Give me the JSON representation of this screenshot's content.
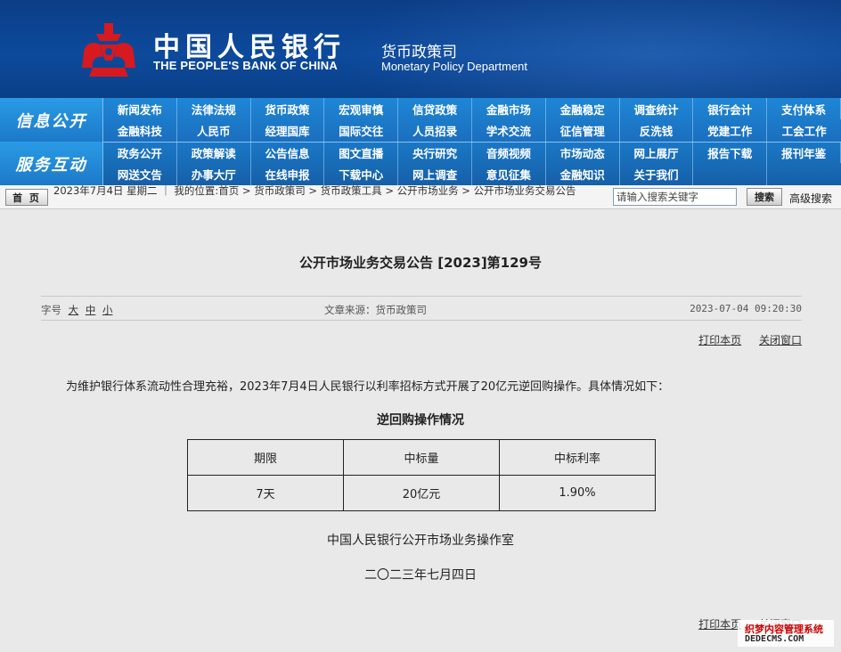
{
  "header": {
    "bank_name_cn": "中国人民银行",
    "bank_name_en": "THE PEOPLE'S BANK OF CHINA",
    "dept_cn": "货币政策司",
    "dept_en": "Monetary Policy Department",
    "logo_color": "#d71920"
  },
  "nav": {
    "sections": [
      {
        "label": "信息公开",
        "rows": [
          [
            "新闻发布",
            "法律法规",
            "货币政策",
            "宏观审慎",
            "信贷政策",
            "金融市场",
            "金融稳定",
            "调查统计",
            "银行会计",
            "支付体系"
          ],
          [
            "金融科技",
            "人民币",
            "经理国库",
            "国际交往",
            "人员招录",
            "学术交流",
            "征信管理",
            "反洗钱",
            "党建工作",
            "工会工作"
          ]
        ]
      },
      {
        "label": "服务互动",
        "rows": [
          [
            "政务公开",
            "政策解读",
            "公告信息",
            "图文直播",
            "央行研究",
            "音频视频",
            "市场动态",
            "网上展厅",
            "报告下载",
            "报刊年鉴"
          ],
          [
            "网送文告",
            "办事大厅",
            "在线申报",
            "下载中心",
            "网上调查",
            "意见征集",
            "金融知识",
            "关于我们",
            "",
            ""
          ]
        ]
      }
    ]
  },
  "crumbbar": {
    "home": "首 页",
    "date": "2023年7月4日",
    "weekday": "星期二",
    "location_label": "我的位置:",
    "crumbs": [
      "首页",
      "货币政策司",
      "货币政策工具",
      "公开市场业务",
      "公开市场业务交易公告"
    ],
    "search_placeholder": "请输入搜索关键字",
    "search_btn": "搜索",
    "advanced": "高级搜索"
  },
  "article": {
    "title": "公开市场业务交易公告 [2023]第129号",
    "font_size_label": "字号",
    "font_sizes": [
      "大",
      "中",
      "小"
    ],
    "source": "文章来源：货币政策司",
    "datetime": "2023-07-04 09:20:30",
    "print": "打印本页",
    "close": "关闭窗口",
    "paragraph": "为维护银行体系流动性合理充裕，2023年7月4日人民银行以利率招标方式开展了20亿元逆回购操作。具体情况如下：",
    "table_title": "逆回购操作情况",
    "table": {
      "headers": [
        "期限",
        "中标量",
        "中标利率"
      ],
      "rows": [
        [
          "7天",
          "20亿元",
          "1.90%"
        ]
      ]
    },
    "signature": "中国人民银行公开市场业务操作室",
    "sign_date": "二〇二三年七月四日"
  },
  "watermark": {
    "line1": "织梦内容管理系统",
    "line2": "DEDECMS.COM"
  }
}
